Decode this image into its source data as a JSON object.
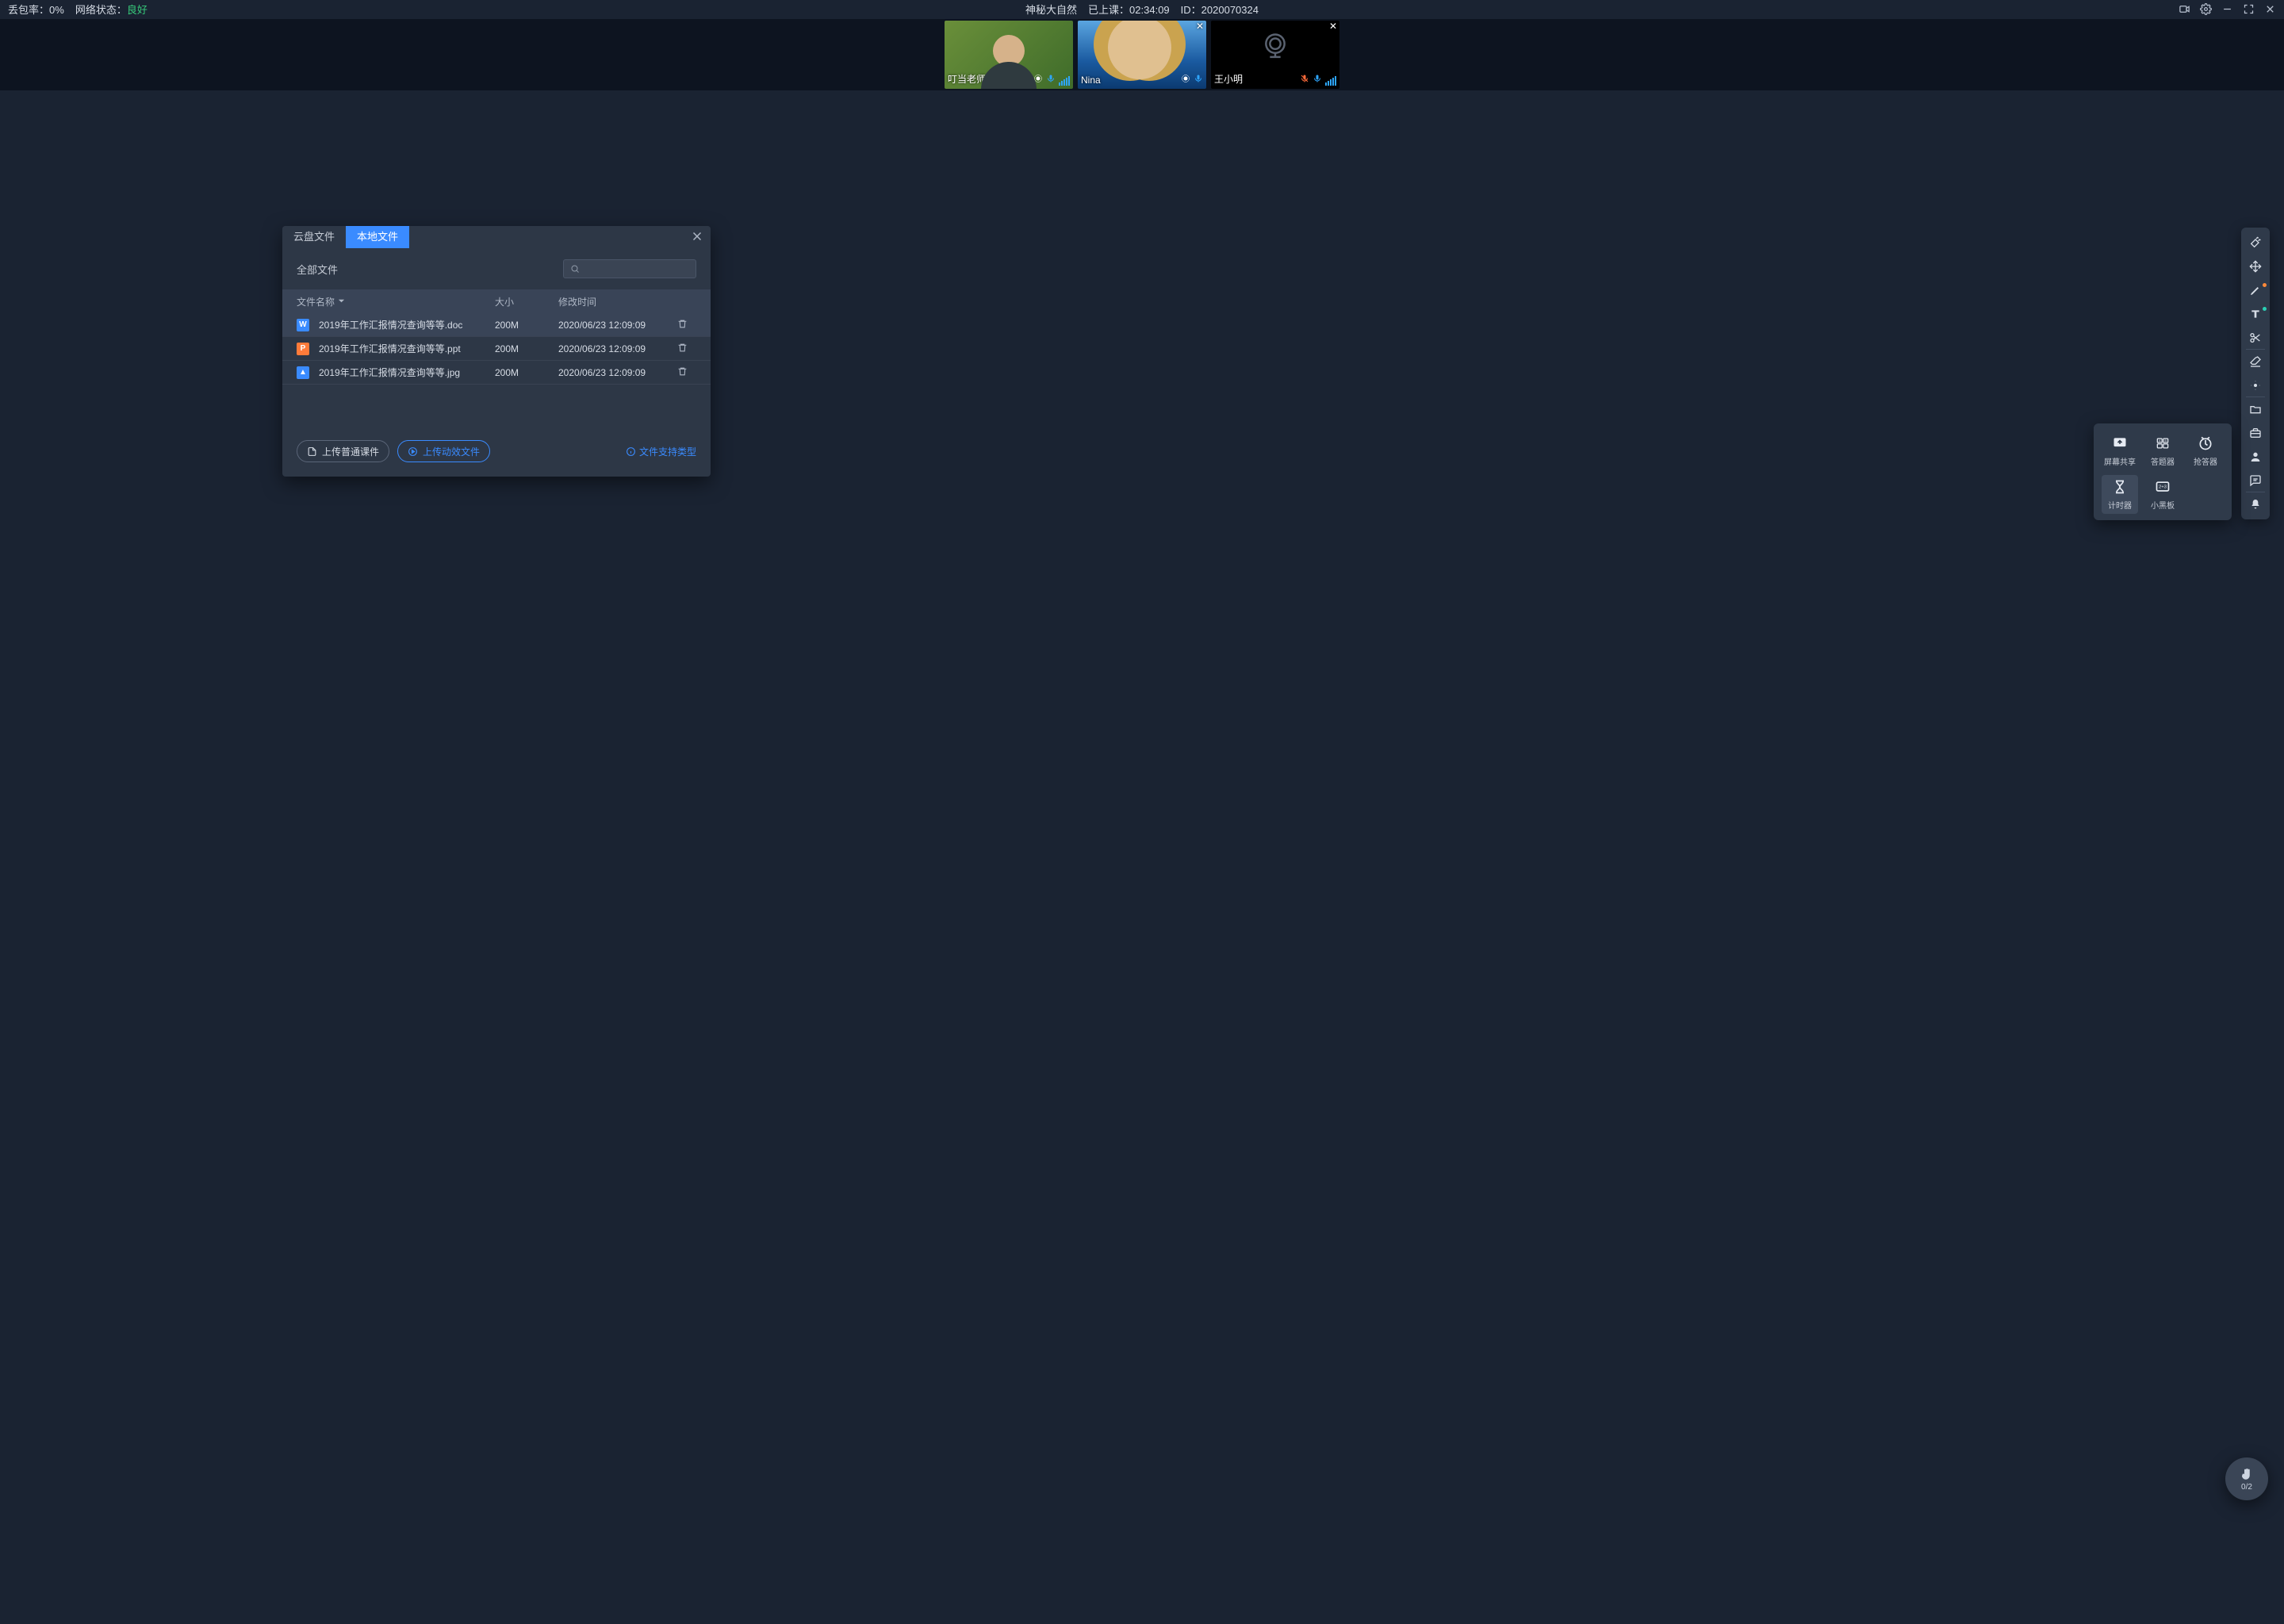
{
  "topbar": {
    "loss_label": "丢包率：",
    "loss_value": "0%",
    "net_label": "网络状态：",
    "net_value": "良好",
    "title": "神秘大自然",
    "elapsed_label": "已上课：",
    "elapsed_value": "02:34:09",
    "id_label": "ID：",
    "id_value": "2020070324"
  },
  "participants": [
    {
      "name": "叮当老师",
      "camera": "on",
      "mic": "on",
      "closeable": false
    },
    {
      "name": "Nina",
      "camera": "on",
      "mic": "on",
      "closeable": true
    },
    {
      "name": "王小明",
      "camera": "off",
      "mic": "muted",
      "closeable": true
    }
  ],
  "dialog": {
    "tab_cloud": "云盘文件",
    "tab_local": "本地文件",
    "all_files": "全部文件",
    "col_name": "文件名称",
    "col_size": "大小",
    "col_time": "修改时间",
    "files": [
      {
        "icon": "doc",
        "glyph": "W",
        "name": "2019年工作汇报情况查询等等.doc",
        "size": "200M",
        "time": "2020/06/23 12:09:09"
      },
      {
        "icon": "ppt",
        "glyph": "P",
        "name": "2019年工作汇报情况查询等等.ppt",
        "size": "200M",
        "time": "2020/06/23 12:09:09"
      },
      {
        "icon": "jpg",
        "glyph": "▲",
        "name": "2019年工作汇报情况查询等等.jpg",
        "size": "200M",
        "time": "2020/06/23 12:09:09"
      }
    ],
    "btn_upload_normal": "上传普通课件",
    "btn_upload_anim": "上传动效文件",
    "support_link": "文件支持类型"
  },
  "tools_pop": {
    "screen_share": "屏幕共享",
    "answerer": "答题器",
    "buzzer": "抢答器",
    "timer": "计时器",
    "blackboard": "小黑板"
  },
  "fab": {
    "count": "0/2"
  }
}
